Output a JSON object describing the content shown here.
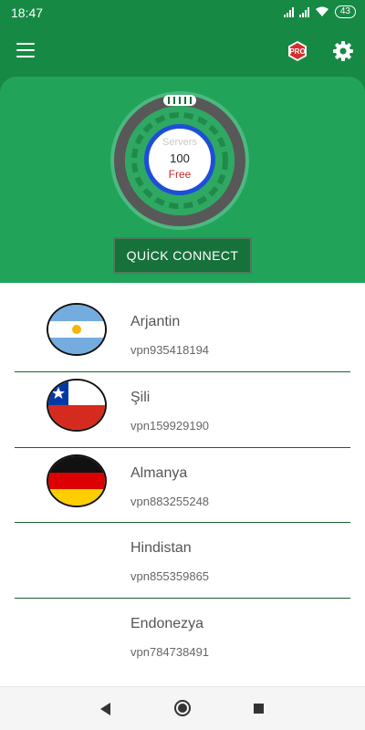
{
  "status_bar": {
    "time": "18:47",
    "battery": "43"
  },
  "app_bar": {
    "menu_icon": "hamburger-menu-icon",
    "pro_badge": "PRO",
    "settings_icon": "gear-icon"
  },
  "dial": {
    "servers_label": "Servers",
    "servers_count": "100",
    "plan_label": "Free"
  },
  "quick_connect_label": "QUİCK CONNECT",
  "servers": [
    {
      "country": "Arjantin",
      "host": "vpn935418194",
      "flag": "argentina-flag-icon"
    },
    {
      "country": "Şili",
      "host": "vpn159929190",
      "flag": "chile-flag-icon"
    },
    {
      "country": "Almanya",
      "host": "vpn883255248",
      "flag": "germany-flag-icon"
    },
    {
      "country": "Hindistan",
      "host": "vpn855359865",
      "flag": ""
    },
    {
      "country": "Endonezya",
      "host": "vpn784738491",
      "flag": ""
    }
  ],
  "colors": {
    "primary": "#168a45",
    "card": "#22a35a",
    "button": "#17713a",
    "ring": "#1d4ed8",
    "free": "#c62828"
  }
}
